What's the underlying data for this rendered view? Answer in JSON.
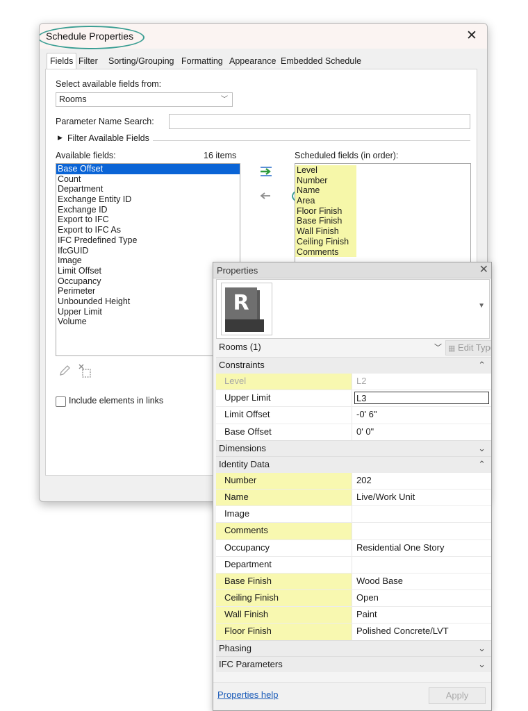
{
  "dialog": {
    "title": "Schedule Properties",
    "tabs": [
      "Fields",
      "Filter",
      "Sorting/Grouping",
      "Formatting",
      "Appearance",
      "Embedded Schedule"
    ],
    "active_tab": "Fields",
    "select_from_label": "Select available fields from:",
    "select_from_value": "Rooms",
    "param_search_label": "Parameter Name Search:",
    "param_search_value": "",
    "filter_available_label": "Filter Available Fields",
    "available_label": "Available fields:",
    "available_count": "16 items",
    "available_fields": [
      "Base Offset",
      "Count",
      "Department",
      "Exchange Entity ID",
      "Exchange ID",
      "Export to IFC",
      "Export to IFC As",
      "IFC Predefined Type",
      "IfcGUID",
      "Image",
      "Limit Offset",
      "Occupancy",
      "Perimeter",
      "Unbounded Height",
      "Upper Limit",
      "Volume"
    ],
    "selected_available": "Base Offset",
    "scheduled_label": "Scheduled fields (in order):",
    "scheduled_fields": [
      "Level",
      "Number",
      "Name",
      "Area",
      "Floor Finish",
      "Base Finish",
      "Wall Finish",
      "Ceiling Finish",
      "Comments"
    ],
    "include_links_label": "Include elements in links",
    "include_links_checked": false,
    "highlight_color": "#f6f7a9",
    "annotation_color": "#3b9e93"
  },
  "properties": {
    "title": "Properties",
    "type_icon": "revit-r-logo",
    "type_icon_letter": "R",
    "selection": "Rooms (1)",
    "edit_type_label": "Edit Type",
    "groups": [
      {
        "name": "Constraints",
        "state": "expanded",
        "rows": [
          {
            "name": "Level",
            "value": "L2",
            "highlight": true,
            "readonly": true
          },
          {
            "name": "Upper Limit",
            "value": "L3",
            "editing": true
          },
          {
            "name": "Limit Offset",
            "value": "-0'  6\""
          },
          {
            "name": "Base Offset",
            "value": "0'  0\""
          }
        ]
      },
      {
        "name": "Dimensions",
        "state": "collapsed",
        "rows": []
      },
      {
        "name": "Identity Data",
        "state": "expanded",
        "rows": [
          {
            "name": "Number",
            "value": "202",
            "highlight": true
          },
          {
            "name": "Name",
            "value": "Live/Work Unit",
            "highlight": true,
            "button": true
          },
          {
            "name": "Image",
            "value": ""
          },
          {
            "name": "Comments",
            "value": "",
            "highlight": true,
            "button": true
          },
          {
            "name": "Occupancy",
            "value": "Residential One Story",
            "button": true
          },
          {
            "name": "Department",
            "value": "",
            "button": true
          },
          {
            "name": "Base Finish",
            "value": "Wood Base",
            "highlight": true,
            "button": true
          },
          {
            "name": "Ceiling Finish",
            "value": "Open",
            "highlight": true,
            "button": true
          },
          {
            "name": "Wall Finish",
            "value": "Paint",
            "highlight": true,
            "button": true
          },
          {
            "name": "Floor Finish",
            "value": "Polished Concrete/LVT",
            "highlight": true,
            "button": true
          }
        ]
      },
      {
        "name": "Phasing",
        "state": "collapsed",
        "rows": []
      },
      {
        "name": "IFC Parameters",
        "state": "collapsed",
        "rows": []
      }
    ],
    "help_link": "Properties help",
    "apply_label": "Apply"
  }
}
